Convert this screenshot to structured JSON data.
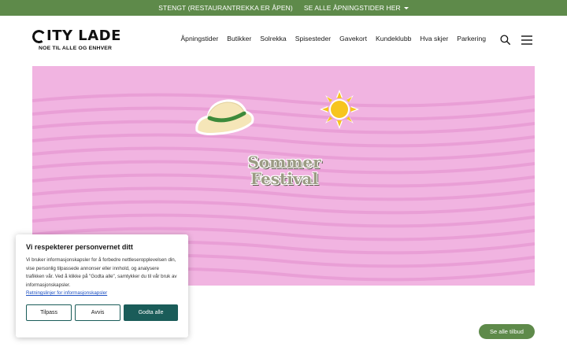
{
  "topbar": {
    "status": "STENGT (RESTAURANTREKKA ER ÅPEN)",
    "hours_link": "SE ALLE ÅPNINGSTIDER HER"
  },
  "logo": {
    "name": "ITY LADE",
    "tagline": "NOE TIL ALLE OG ENHVER"
  },
  "nav": {
    "items": [
      "Åpningstider",
      "Butikker",
      "Solrekka",
      "Spisesteder",
      "Gavekort",
      "Kundeklubb",
      "Hva skjer",
      "Parkering"
    ]
  },
  "hero": {
    "line1": "Sommer",
    "line2": "Festival",
    "bg_color": "#f1b4e1"
  },
  "cookie": {
    "title": "Vi respekterer personvernet ditt",
    "body": "Vi bruker informasjonskapsler for å forbedre nettleseropplevelsen din, vise personlig tilpassede annonser eller innhold, og analysere trafikken vår. Ved å klikke på \"Godta alle\", samtykker du til vår bruk av informasjonskapsler.",
    "policy_link": "Retningslinjer for informasjonskapsler",
    "customize_label": "Tilpass",
    "reject_label": "Avvis",
    "accept_label": "Godta alle"
  },
  "offers": {
    "label": "Se alle tilbud"
  },
  "colors": {
    "green": "#5e8a4a",
    "teal": "#1a5c59",
    "pink": "#f1b4e1"
  }
}
